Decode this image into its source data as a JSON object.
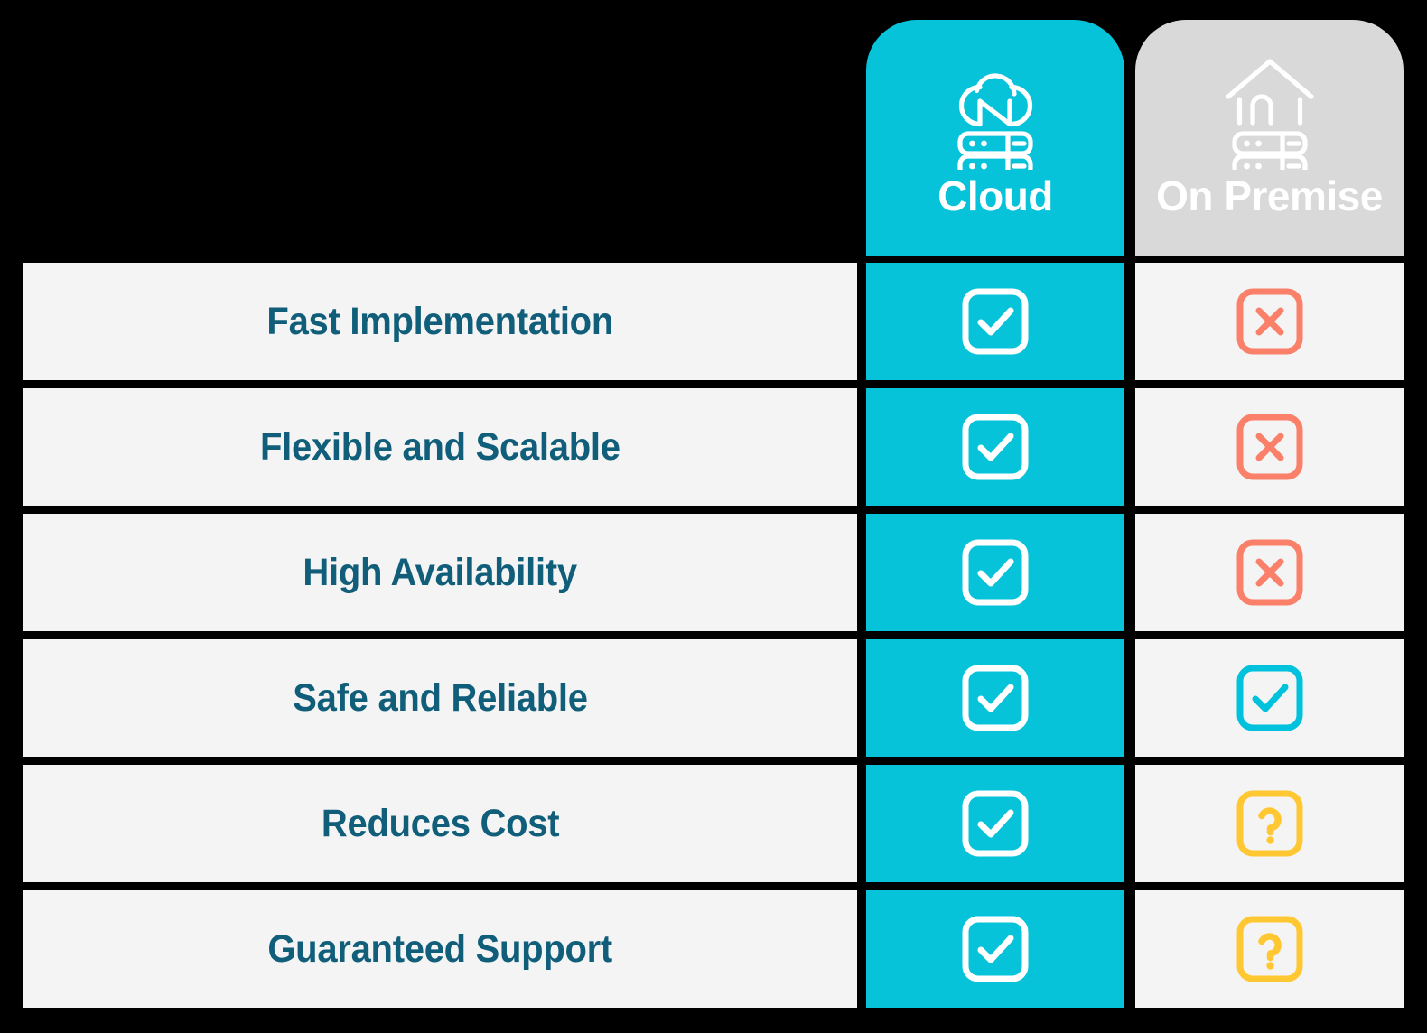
{
  "colors": {
    "cloud_accent": "#06c3da",
    "onprem_header": "#d9d9d9",
    "row_background": "#f4f4f4",
    "label_text": "#105e79",
    "page_background": "#000000",
    "cross_red": "#fb8069",
    "check_cyan": "#00c2dd",
    "question_yellow": "#ffc832",
    "check_white": "#ffffff"
  },
  "columns": [
    {
      "key": "cloud",
      "label": "Cloud",
      "icon": "cloud-server-icon"
    },
    {
      "key": "onprem",
      "label": "On Premise",
      "icon": "house-server-icon"
    }
  ],
  "rows": [
    {
      "label": "Fast Implementation",
      "cloud": {
        "status": "yes",
        "icon": "check-square-icon"
      },
      "onprem": {
        "status": "no",
        "icon": "cross-square-icon"
      }
    },
    {
      "label": "Flexible and Scalable",
      "cloud": {
        "status": "yes",
        "icon": "check-square-icon"
      },
      "onprem": {
        "status": "no",
        "icon": "cross-square-icon"
      }
    },
    {
      "label": "High Availability",
      "cloud": {
        "status": "yes",
        "icon": "check-square-icon"
      },
      "onprem": {
        "status": "no",
        "icon": "cross-square-icon"
      }
    },
    {
      "label": "Safe and Reliable",
      "cloud": {
        "status": "yes",
        "icon": "check-square-icon"
      },
      "onprem": {
        "status": "yes",
        "icon": "check-square-icon"
      }
    },
    {
      "label": "Reduces Cost",
      "cloud": {
        "status": "yes",
        "icon": "check-square-icon"
      },
      "onprem": {
        "status": "maybe",
        "icon": "question-square-icon"
      }
    },
    {
      "label": "Guaranteed Support",
      "cloud": {
        "status": "yes",
        "icon": "check-square-icon"
      },
      "onprem": {
        "status": "maybe",
        "icon": "question-square-icon"
      }
    }
  ]
}
